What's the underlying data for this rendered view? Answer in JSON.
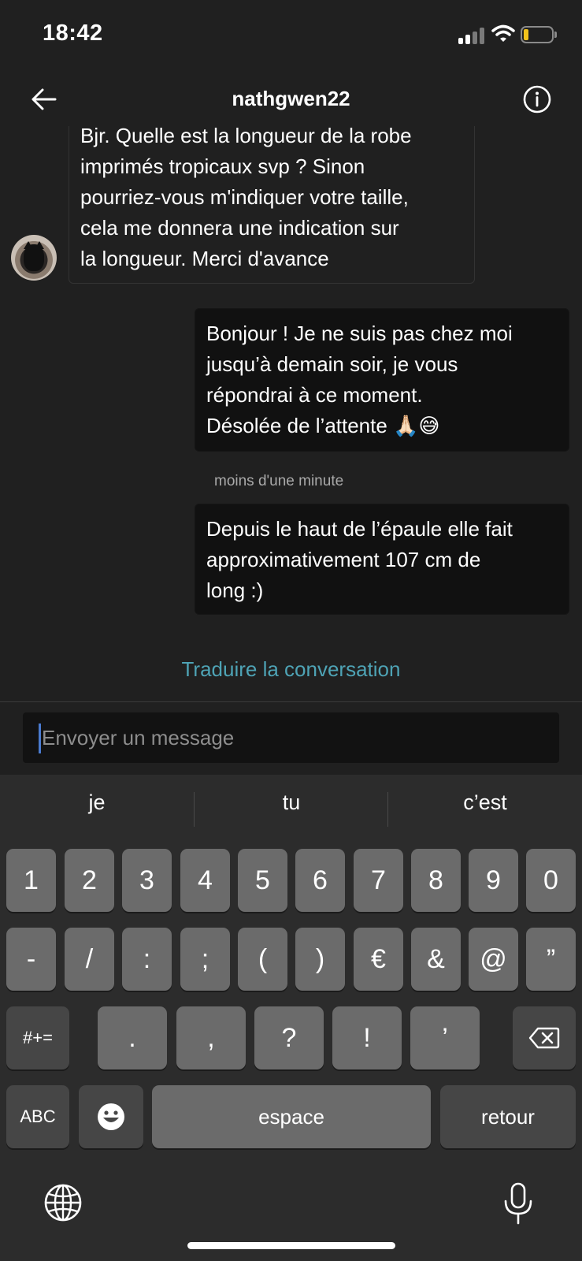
{
  "status_bar": {
    "time": "18:42"
  },
  "header": {
    "title": "nathgwen22"
  },
  "messages": {
    "incoming": {
      "lines": [
        "Bjr. Quelle est la longueur de la robe",
        "imprimés tropicaux svp ? Sinon",
        "pourriez-vous m'indiquer votre taille,",
        "cela me donnera une indication sur",
        "la longueur. Merci d'avance"
      ]
    },
    "outgoing_1": {
      "lines": [
        "Bonjour ! Je ne suis pas chez moi",
        "jusqu’à demain soir, je vous",
        "répondrai à ce moment.",
        "Désolée de l’attente 🙏🏻😅"
      ]
    },
    "timestamp": "moins d'une minute",
    "outgoing_2": {
      "lines": [
        "Depuis le haut de l’épaule elle fait",
        "approximativement 107 cm de",
        "long :)"
      ]
    }
  },
  "translate_label": "Traduire la conversation",
  "composer": {
    "placeholder": "Envoyer un message",
    "value": ""
  },
  "keyboard": {
    "suggestions": [
      "je",
      "tu",
      "c’est"
    ],
    "row1": [
      "1",
      "2",
      "3",
      "4",
      "5",
      "6",
      "7",
      "8",
      "9",
      "0"
    ],
    "row2": [
      "-",
      "/",
      ":",
      ";",
      "(",
      ")",
      "€",
      "&",
      "@",
      "”"
    ],
    "row3": {
      "shift": "#+=",
      "keys": [
        ".",
        ",",
        "?",
        "!",
        "’"
      ]
    },
    "row4": {
      "abc": "ABC",
      "space": "espace",
      "return": "retour"
    }
  },
  "icons": {
    "back": "arrow-left-icon",
    "info": "info-circle-icon",
    "delete": "backspace-icon",
    "emoji": "smiley-icon",
    "globe": "globe-icon",
    "mic": "microphone-icon"
  },
  "colors": {
    "accent_link": "#4ea3b5",
    "caret": "#4a7bd0",
    "battery": "#f1c21b"
  }
}
